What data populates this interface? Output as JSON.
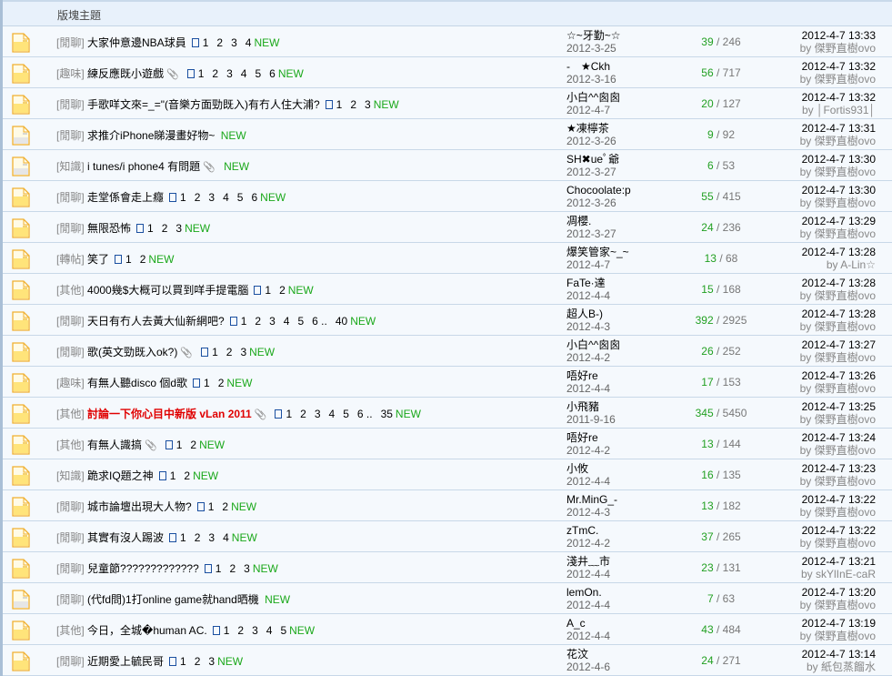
{
  "header": {
    "subject_col": "版塊主題"
  },
  "new_label": "NEW",
  "by_label": "by",
  "colors": {
    "new": "#1aa81a",
    "highlight": "#e00000",
    "replies": "#22a022"
  },
  "threads": [
    {
      "cat": "[閒聊]",
      "title": "大家仲意邊NBA球員",
      "clip": false,
      "pages": [
        "1",
        "2",
        "3",
        "4"
      ],
      "author": "☆~牙勤~☆",
      "date": "2012-3-25",
      "replies": "39",
      "views": "246",
      "last_time": "2012-4-7 13:33",
      "last_by": "傑野直樹ovo",
      "icon": "folder"
    },
    {
      "cat": "[趣味]",
      "title": "練反應既小遊戲",
      "clip": true,
      "pages": [
        "1",
        "2",
        "3",
        "4",
        "5",
        "6"
      ],
      "author": "-　★Ckh",
      "date": "2012-3-16",
      "replies": "56",
      "views": "717",
      "last_time": "2012-4-7 13:32",
      "last_by": "傑野直樹ovo",
      "icon": "folder"
    },
    {
      "cat": "[閒聊]",
      "title": "手歌咩文來=_=\"(音樂方面勁既入)有冇人住大浦?",
      "clip": false,
      "pages": [
        "1",
        "2",
        "3"
      ],
      "author": "小白^^囪囪",
      "date": "2012-4-7",
      "replies": "20",
      "views": "127",
      "last_time": "2012-4-7 13:32",
      "last_by": "│Fortis931│",
      "icon": "folder"
    },
    {
      "cat": "[閒聊]",
      "title": "求推介iPhone睇漫畫好物~",
      "clip": false,
      "pages": [],
      "author": "★凍檸茶",
      "date": "2012-3-26",
      "replies": "9",
      "views": "92",
      "last_time": "2012-4-7 13:31",
      "last_by": "傑野直樹ovo",
      "icon": "grey"
    },
    {
      "cat": "[知識]",
      "title": "i tunes/i phone4 有問題",
      "clip": true,
      "pages": [],
      "author": "SH✖ueﾟ爺",
      "date": "2012-3-27",
      "replies": "6",
      "views": "53",
      "last_time": "2012-4-7 13:30",
      "last_by": "傑野直樹ovo",
      "icon": "grey"
    },
    {
      "cat": "[閒聊]",
      "title": "走堂係會走上癮",
      "clip": false,
      "pages": [
        "1",
        "2",
        "3",
        "4",
        "5",
        "6"
      ],
      "author": "Chocoolate:p",
      "date": "2012-3-26",
      "replies": "55",
      "views": "415",
      "last_time": "2012-4-7 13:30",
      "last_by": "傑野直樹ovo",
      "icon": "folder"
    },
    {
      "cat": "[閒聊]",
      "title": "無限恐怖",
      "clip": false,
      "pages": [
        "1",
        "2",
        "3"
      ],
      "author": "凋櫻.",
      "date": "2012-3-27",
      "replies": "24",
      "views": "236",
      "last_time": "2012-4-7 13:29",
      "last_by": "傑野直樹ovo",
      "icon": "folder"
    },
    {
      "cat": "[轉帖]",
      "title": "笑了",
      "clip": false,
      "pages": [
        "1",
        "2"
      ],
      "author": "爆笑管家~_~",
      "date": "2012-4-7",
      "replies": "13",
      "views": "68",
      "last_time": "2012-4-7 13:28",
      "last_by": "A-Lin☆",
      "icon": "folder"
    },
    {
      "cat": "[其他]",
      "title": "4000幾$大概可以買到咩手提電腦",
      "clip": false,
      "pages": [
        "1",
        "2"
      ],
      "author": "FaTe·達",
      "date": "2012-4-4",
      "replies": "15",
      "views": "168",
      "last_time": "2012-4-7 13:28",
      "last_by": "傑野直樹ovo",
      "icon": "folder"
    },
    {
      "cat": "[閒聊]",
      "title": "天日有冇人去黃大仙新網吧?",
      "clip": false,
      "pages": [
        "1",
        "2",
        "3",
        "4",
        "5",
        "6 ..",
        "40"
      ],
      "author": "超人B-)",
      "date": "2012-4-3",
      "replies": "392",
      "views": "2925",
      "last_time": "2012-4-7 13:28",
      "last_by": "傑野直樹ovo",
      "icon": "folder"
    },
    {
      "cat": "[閒聊]",
      "title": "歌(英文勁既入ok?)",
      "clip": true,
      "pages": [
        "1",
        "2",
        "3"
      ],
      "author": "小白^^囪囪",
      "date": "2012-4-2",
      "replies": "26",
      "views": "252",
      "last_time": "2012-4-7 13:27",
      "last_by": "傑野直樹ovo",
      "icon": "folder"
    },
    {
      "cat": "[趣味]",
      "title": "有無人聽disco 個d歌",
      "clip": false,
      "pages": [
        "1",
        "2"
      ],
      "author": "唔好re",
      "date": "2012-4-4",
      "replies": "17",
      "views": "153",
      "last_time": "2012-4-7 13:26",
      "last_by": "傑野直樹ovo",
      "icon": "folder"
    },
    {
      "cat": "[其他]",
      "title": "討論一下你心目中新版 vLan 2011",
      "highlight": true,
      "clip": true,
      "pages": [
        "1",
        "2",
        "3",
        "4",
        "5",
        "6 ..",
        "35"
      ],
      "author": "小飛豬",
      "date": "2011-9-16",
      "replies": "345",
      "views": "5450",
      "last_time": "2012-4-7 13:25",
      "last_by": "傑野直樹ovo",
      "icon": "folder"
    },
    {
      "cat": "[其他]",
      "title": "有無人識搞",
      "clip": true,
      "pages": [
        "1",
        "2"
      ],
      "author": "唔好re",
      "date": "2012-4-2",
      "replies": "13",
      "views": "144",
      "last_time": "2012-4-7 13:24",
      "last_by": "傑野直樹ovo",
      "icon": "folder"
    },
    {
      "cat": "[知識]",
      "title": "跪求IQ題之神",
      "clip": false,
      "pages": [
        "1",
        "2"
      ],
      "author": "小攸",
      "date": "2012-4-4",
      "replies": "16",
      "views": "135",
      "last_time": "2012-4-7 13:23",
      "last_by": "傑野直樹ovo",
      "icon": "folder"
    },
    {
      "cat": "[閒聊]",
      "title": "城市論壇出現大人物?",
      "clip": false,
      "pages": [
        "1",
        "2"
      ],
      "author": "Mr.MinG_-",
      "date": "2012-4-3",
      "replies": "13",
      "views": "182",
      "last_time": "2012-4-7 13:22",
      "last_by": "傑野直樹ovo",
      "icon": "folder"
    },
    {
      "cat": "[閒聊]",
      "title": "其實有沒人踢波",
      "clip": false,
      "pages": [
        "1",
        "2",
        "3",
        "4"
      ],
      "author": "zTmC.",
      "date": "2012-4-2",
      "replies": "37",
      "views": "265",
      "last_time": "2012-4-7 13:22",
      "last_by": "傑野直樹ovo",
      "icon": "folder"
    },
    {
      "cat": "[閒聊]",
      "title": "兒童節?????????????",
      "clip": false,
      "pages": [
        "1",
        "2",
        "3"
      ],
      "author": "淺井﹏市",
      "date": "2012-4-4",
      "replies": "23",
      "views": "131",
      "last_time": "2012-4-7 13:21",
      "last_by": "skYlInE-caR",
      "icon": "folder"
    },
    {
      "cat": "[閒聊]",
      "title": "(代fd問)1打online game就hand晒機",
      "clip": false,
      "pages": [],
      "author": "lemOn.",
      "date": "2012-4-4",
      "replies": "7",
      "views": "63",
      "last_time": "2012-4-7 13:20",
      "last_by": "傑野直樹ovo",
      "icon": "grey"
    },
    {
      "cat": "[其他]",
      "title": "今日，全城�human AC.",
      "clip": false,
      "pages": [
        "1",
        "2",
        "3",
        "4",
        "5"
      ],
      "author": "A_c",
      "date": "2012-4-4",
      "replies": "43",
      "views": "484",
      "last_time": "2012-4-7 13:19",
      "last_by": "傑野直樹ovo",
      "icon": "folder"
    },
    {
      "cat": "[閒聊]",
      "title": "近期愛上毓民哥",
      "clip": false,
      "pages": [
        "1",
        "2",
        "3"
      ],
      "author": "花汶",
      "date": "2012-4-6",
      "replies": "24",
      "views": "271",
      "last_time": "2012-4-7 13:14",
      "last_by": "紙包蒸餾水",
      "icon": "folder"
    }
  ]
}
